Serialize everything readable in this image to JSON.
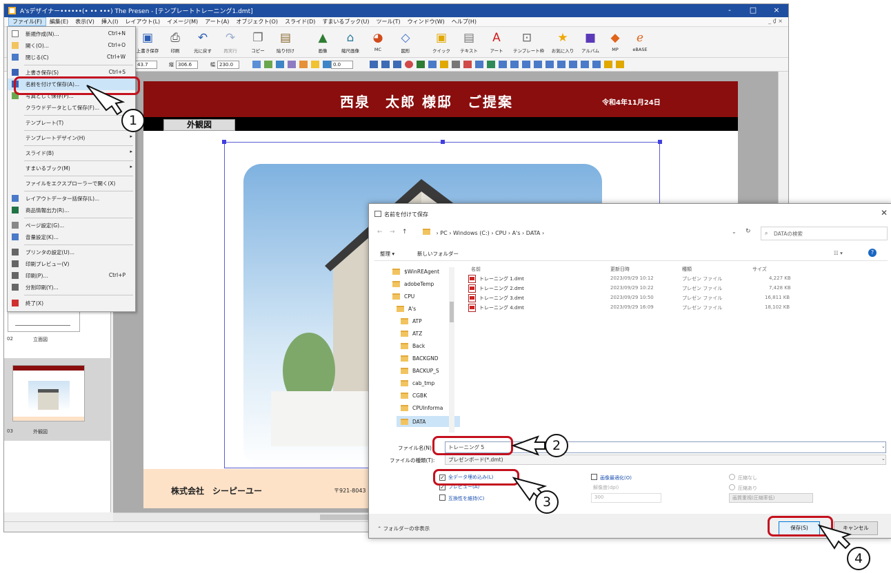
{
  "app": {
    "title": "A'sデザイナー••••••(• •• •••) The Presen - [テンプレートトレーニング1.dmt]",
    "window_controls": [
      "-",
      "□",
      "×"
    ]
  },
  "menubar": {
    "items": [
      "ファイル(F)",
      "編集(E)",
      "表示(V)",
      "挿入(I)",
      "レイアウト(L)",
      "イメージ(M)",
      "アート(A)",
      "オブジェクト(O)",
      "スライド(D)",
      "すまいるブック(U)",
      "ツール(T)",
      "ウィンドウ(W)",
      "ヘルプ(H)"
    ],
    "mdi_controls": "_ ₫ ×"
  },
  "toolbar": {
    "buttons": [
      "上書き保存",
      "印刷",
      "元に戻す",
      "再実行",
      "コピー",
      "貼り付け",
      "画像",
      "縮尺画像",
      "MC",
      "図形",
      "クイック",
      "テキスト",
      "アート",
      "テンプレート枠",
      "お気に入り",
      "アルバム",
      "MP",
      "eBASE"
    ]
  },
  "properties": {
    "x_value": "43.7",
    "y_label": "縦",
    "y_value": "306.6",
    "w_label": "幅",
    "w_value": "230.0",
    "zoom_value": "0.0"
  },
  "file_menu": {
    "items": [
      {
        "label": "新規作成(N)...",
        "shortcut": "Ctrl+N"
      },
      {
        "label": "開く(O)...",
        "shortcut": "Ctrl+O"
      },
      {
        "label": "閉じる(C)",
        "shortcut": "Ctrl+W"
      },
      {
        "label": "上書き保存(S)",
        "shortcut": "Ctrl+S"
      },
      {
        "label": "名前を付けて保存(A)...",
        "shortcut": ""
      },
      {
        "label": "写真として保存(P)...",
        "shortcut": ""
      },
      {
        "label": "クラウドデータとして保存(F)...",
        "shortcut": ""
      },
      {
        "label": "テンプレート(T)",
        "shortcut": ""
      },
      {
        "label": "テンプレートデザイン(H)",
        "shortcut": ""
      },
      {
        "label": "スライド(B)",
        "shortcut": ""
      },
      {
        "label": "すまいるブック(M)",
        "shortcut": ""
      },
      {
        "label": "ファイルをエクスプローラーで開く(X)",
        "shortcut": ""
      },
      {
        "label": "レイアウトデーター括保存(L)...",
        "shortcut": ""
      },
      {
        "label": "商品情報出力(R)...",
        "shortcut": ""
      },
      {
        "label": "ページ設定(G)...",
        "shortcut": ""
      },
      {
        "label": "音量設定(K)...",
        "shortcut": ""
      },
      {
        "label": "プリンタの設定(U)...",
        "shortcut": ""
      },
      {
        "label": "印刷プレビュー(V)",
        "shortcut": ""
      },
      {
        "label": "印刷(P)...",
        "shortcut": "Ctrl+P"
      },
      {
        "label": "分割印刷(Y)...",
        "shortcut": ""
      },
      {
        "label": "終了(X)",
        "shortcut": ""
      }
    ]
  },
  "slides": [
    {
      "number": "02",
      "name": "立面図"
    },
    {
      "number": "03",
      "name": "外観図"
    }
  ],
  "slide_side_num": "01",
  "canvas": {
    "banner_title": "西泉　太郎 様邸　ご提案",
    "banner_date": "令和4年11月24日",
    "section_label": "外観図",
    "company": "株式会社　シーピーユー",
    "address": "〒921-8043　石川県金"
  },
  "dialog": {
    "title": "名前を付けて保存",
    "path": [
      "PC",
      "Windows (C:)",
      "CPU",
      "A's",
      "DATA"
    ],
    "search_placeholder": "DATAの検索",
    "organize": "整理 ▾",
    "new_folder": "新しいフォルダー",
    "nav_items": [
      "$WinREAgent",
      "adobeTemp",
      "CPU",
      "A's",
      "ATP",
      "ATZ",
      "Back",
      "BACKGND",
      "BACKUP_S",
      "cab_tmp",
      "CGBK",
      "CPUInforma",
      "DATA"
    ],
    "columns": [
      "名前",
      "更新日時",
      "種類",
      "サイズ"
    ],
    "files": [
      {
        "name": "トレーニング 1.dmt",
        "date": "2023/09/29 10:12",
        "type": "プレゼン ファイル",
        "size": "4,227 KB"
      },
      {
        "name": "トレーニング 2.dmt",
        "date": "2023/09/29 10:22",
        "type": "プレゼン ファイル",
        "size": "7,428 KB"
      },
      {
        "name": "トレーニング 3.dmt",
        "date": "2023/09/29 10:50",
        "type": "プレゼン ファイル",
        "size": "16,811 KB"
      },
      {
        "name": "トレーニング 4.dmt",
        "date": "2023/09/29 16:09",
        "type": "プレゼン ファイル",
        "size": "18,102 KB"
      }
    ],
    "filename_label": "ファイル名(N):",
    "filename_value": "トレーニング 5",
    "filetype_label": "ファイルの種類(T):",
    "filetype_value": "プレゼンボード(*.dmt)",
    "options": {
      "embed_all": "全データ埋め込み(L)",
      "preview": "プレビュー(A)",
      "compat": "互換性を維持(C)",
      "optimize": "画像最適化(O)",
      "resolution_label": "解像度(dpi)",
      "resolution_value": "300",
      "no_compress": "圧縮なし",
      "compress": "圧縮あり",
      "quality": "画質重視(圧縮率低)"
    },
    "save_label": "保存(S)",
    "cancel_label": "キャンセル",
    "folder_toggle": "フォルダーの非表示"
  },
  "callouts": [
    "1",
    "2",
    "3",
    "4"
  ],
  "colors": {
    "banner": "#8a0e0e",
    "footer": "#fde2c8",
    "titlebar": "#1f4fa0",
    "callout": "#c4101e"
  }
}
